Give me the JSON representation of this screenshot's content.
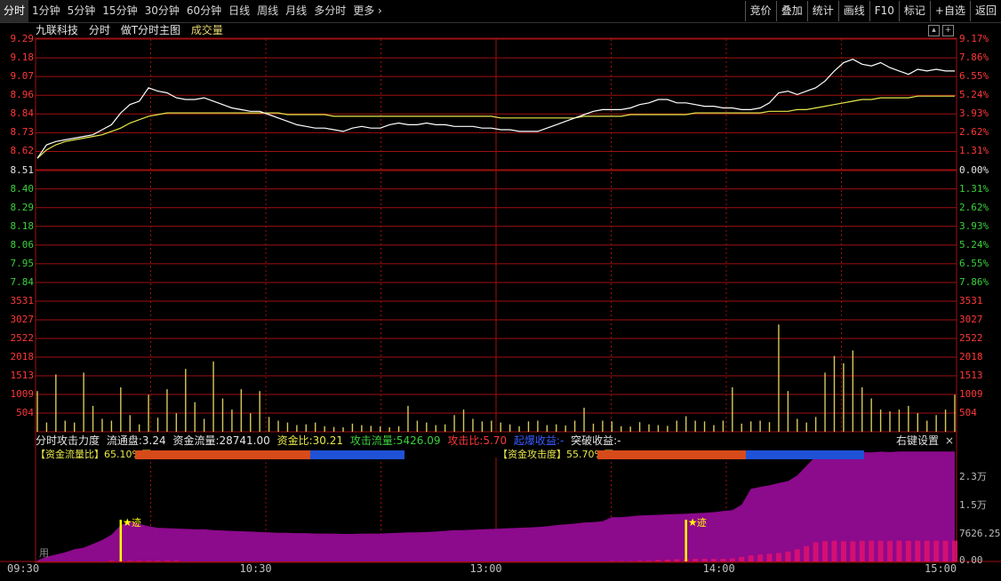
{
  "toolbar": {
    "left_items": [
      "分时",
      "1分钟",
      "5分钟",
      "15分钟",
      "30分钟",
      "60分钟",
      "日线",
      "周线",
      "月线",
      "多分时",
      "更多"
    ],
    "right_items": [
      "竞价",
      "叠加",
      "统计",
      "画线",
      "F10",
      "标记",
      "+自选",
      "返回"
    ]
  },
  "title": {
    "stock": "九联科技",
    "mode": "分时",
    "template": "做T分时主图",
    "volume": "成交量"
  },
  "price_axis": {
    "left": [
      "9.29",
      "9.18",
      "9.07",
      "8.96",
      "8.84",
      "8.73",
      "8.62",
      "8.51",
      "8.40",
      "8.29",
      "8.18",
      "8.06",
      "7.95",
      "7.84"
    ],
    "right": [
      "9.17%",
      "7.86%",
      "6.55%",
      "5.24%",
      "3.93%",
      "2.62%",
      "1.31%",
      "0.00%",
      "1.31%",
      "2.62%",
      "3.93%",
      "5.24%",
      "6.55%",
      "7.86%"
    ]
  },
  "volume_axis": [
    "3531",
    "3027",
    "2522",
    "2018",
    "1513",
    "1009",
    "504"
  ],
  "indicator": {
    "name": "分时攻击力度",
    "float_label": "流通盘:",
    "float_value": "3.24",
    "fund_flow_label": "资金流量:",
    "fund_flow_value": "28741.00",
    "fund_ratio_label": "资金比:",
    "fund_ratio_value": "30.21",
    "attack_flow_label": "攻击流量:",
    "attack_flow_value": "5426.09",
    "attack_ratio_label": "攻击比:",
    "attack_ratio_value": "5.70",
    "launch_label": "起爆收益:",
    "launch_value": "-",
    "breakout_label": "突破收益:",
    "breakout_value": "-",
    "settings_label": "右键设置",
    "close_icon": "×"
  },
  "ratios": {
    "flow": {
      "label": "【资金流量比】",
      "value": "65.10",
      "suffix": "%买",
      "fraction": 0.651
    },
    "attack": {
      "label": "【资金攻击度】",
      "value": "55.70",
      "suffix": "%买",
      "fraction": 0.557
    }
  },
  "lower_axis": [
    "2.3万",
    "1.5万",
    "7626.25",
    "0.00"
  ],
  "lower_marker": {
    "glyph": "★",
    "label": "迹"
  },
  "lower_corner": "用",
  "time_axis": [
    "09:30",
    "10:30",
    "13:00",
    "14:00",
    "15:00"
  ],
  "colors": {
    "price_line": "#ffffff",
    "avg_line": "#e8e84a",
    "grid": "#a01010",
    "volume_bar": "#d8c85a",
    "area_fill": "#8c0a8c",
    "attack_fill": "#e0106e",
    "marker": "#ffff00",
    "ratio_red": "#d74a1a",
    "ratio_blue": "#1f52d6"
  },
  "chart_data": {
    "type": "line",
    "x_range": [
      "09:30",
      "15:00"
    ],
    "ylim": [
      7.84,
      9.29
    ],
    "prev_close": 8.51,
    "series": [
      {
        "values": [
          8.58,
          8.66,
          8.68,
          8.69,
          8.7,
          8.71,
          8.72,
          8.75,
          8.78,
          8.85,
          8.9,
          8.92,
          9.0,
          8.98,
          8.97,
          8.94,
          8.93,
          8.93,
          8.94,
          8.92,
          8.9,
          8.88,
          8.87,
          8.86,
          8.86,
          8.84,
          8.82,
          8.8,
          8.78,
          8.77,
          8.76,
          8.76,
          8.75,
          8.74,
          8.76,
          8.77,
          8.76,
          8.76,
          8.78,
          8.79,
          8.78,
          8.78,
          8.79,
          8.78,
          8.78,
          8.77,
          8.77,
          8.77,
          8.76,
          8.76,
          8.75,
          8.75,
          8.74,
          8.74,
          8.74,
          8.76,
          8.78,
          8.8,
          8.82,
          8.84,
          8.86,
          8.87,
          8.87,
          8.87,
          8.88,
          8.9,
          8.91,
          8.93,
          8.93,
          8.91,
          8.91,
          8.9,
          8.89,
          8.89,
          8.88,
          8.88,
          8.87,
          8.87,
          8.88,
          8.91,
          8.97,
          8.98,
          8.96,
          8.98,
          9.0,
          9.04,
          9.1,
          9.15,
          9.17,
          9.14,
          9.13,
          9.15,
          9.12,
          9.1,
          9.08,
          9.11,
          9.1,
          9.11,
          9.1,
          9.1
        ]
      },
      {
        "values": [
          8.58,
          8.63,
          8.66,
          8.68,
          8.69,
          8.7,
          8.71,
          8.72,
          8.74,
          8.76,
          8.79,
          8.81,
          8.83,
          8.84,
          8.85,
          8.85,
          8.85,
          8.85,
          8.85,
          8.85,
          8.85,
          8.85,
          8.85,
          8.85,
          8.85,
          8.85,
          8.85,
          8.84,
          8.84,
          8.84,
          8.84,
          8.84,
          8.83,
          8.83,
          8.83,
          8.83,
          8.83,
          8.83,
          8.83,
          8.83,
          8.83,
          8.83,
          8.83,
          8.83,
          8.83,
          8.83,
          8.83,
          8.83,
          8.83,
          8.83,
          8.82,
          8.82,
          8.82,
          8.82,
          8.82,
          8.82,
          8.82,
          8.82,
          8.82,
          8.83,
          8.83,
          8.83,
          8.83,
          8.83,
          8.84,
          8.84,
          8.84,
          8.84,
          8.84,
          8.84,
          8.84,
          8.85,
          8.85,
          8.85,
          8.85,
          8.85,
          8.85,
          8.85,
          8.85,
          8.86,
          8.86,
          8.86,
          8.87,
          8.87,
          8.88,
          8.89,
          8.9,
          8.91,
          8.92,
          8.93,
          8.93,
          8.94,
          8.94,
          8.94,
          8.94,
          8.95,
          8.95,
          8.95,
          8.95,
          8.95
        ]
      }
    ],
    "volume": {
      "ylim": [
        0,
        3531
      ],
      "values": [
        1100,
        250,
        1550,
        300,
        250,
        1600,
        700,
        350,
        300,
        1200,
        450,
        200,
        1000,
        380,
        1150,
        500,
        1700,
        800,
        350,
        1900,
        900,
        600,
        1150,
        500,
        1100,
        400,
        300,
        250,
        180,
        200,
        250,
        150,
        130,
        120,
        220,
        180,
        160,
        140,
        120,
        150,
        700,
        300,
        250,
        180,
        200,
        450,
        600,
        350,
        280,
        300,
        250,
        200,
        150,
        280,
        300,
        180,
        200,
        170,
        300,
        650,
        220,
        300,
        280,
        150,
        140,
        260,
        200,
        180,
        160,
        300,
        420,
        300,
        280,
        180,
        300,
        1200,
        220,
        280,
        300,
        260,
        2900,
        1100,
        350,
        250,
        400,
        1600,
        2050,
        1850,
        2200,
        1200,
        900,
        600,
        550,
        600,
        700,
        500,
        300,
        450,
        600,
        1000
      ]
    },
    "fund_flow": {
      "ylim": [
        0,
        29500
      ],
      "values": [
        300,
        1200,
        1800,
        2400,
        3200,
        3600,
        4600,
        5600,
        7000,
        9500,
        10500,
        9800,
        9200,
        8800,
        8700,
        8600,
        8500,
        8400,
        8400,
        8200,
        8100,
        8000,
        7900,
        7800,
        7700,
        7600,
        7500,
        7500,
        7400,
        7400,
        7300,
        7300,
        7300,
        7200,
        7200,
        7300,
        7300,
        7300,
        7400,
        7500,
        7600,
        7600,
        7700,
        7800,
        8000,
        8200,
        8200,
        8300,
        8400,
        8500,
        8600,
        8700,
        8800,
        8900,
        9000,
        9200,
        9500,
        9700,
        9900,
        10200,
        10300,
        10500,
        11600,
        11600,
        11800,
        12000,
        12100,
        12200,
        12300,
        12400,
        12500,
        12600,
        12700,
        12900,
        13200,
        13400,
        14800,
        19000,
        19500,
        19900,
        20500,
        21000,
        22500,
        25000,
        27500,
        28000,
        28500,
        28600,
        28741,
        28600,
        28500,
        28700,
        28600,
        28741,
        28741,
        28741,
        28741,
        28741,
        28741,
        28741
      ]
    },
    "attack_flow": {
      "values": [
        0,
        0,
        0,
        0,
        0,
        0,
        0,
        0,
        200,
        200,
        200,
        200,
        200,
        200,
        200,
        200,
        0,
        0,
        0,
        0,
        0,
        0,
        0,
        0,
        0,
        0,
        0,
        0,
        0,
        0,
        0,
        0,
        0,
        0,
        0,
        0,
        0,
        0,
        0,
        0,
        0,
        0,
        0,
        0,
        0,
        0,
        0,
        0,
        0,
        0,
        0,
        0,
        0,
        0,
        0,
        0,
        0,
        0,
        0,
        0,
        0,
        0,
        100,
        100,
        100,
        200,
        200,
        400,
        500,
        600,
        600,
        700,
        700,
        700,
        700,
        800,
        1200,
        1600,
        1800,
        2000,
        2200,
        2600,
        3200,
        4000,
        5000,
        5300,
        5400,
        5300,
        5300,
        5400,
        5426,
        5400,
        5400,
        5426,
        5400,
        5426,
        5426,
        5426,
        5426,
        5426
      ]
    },
    "markers": [
      {
        "x_index": 9,
        "label": "迹"
      },
      {
        "x_index": 70,
        "label": "迹"
      }
    ]
  }
}
